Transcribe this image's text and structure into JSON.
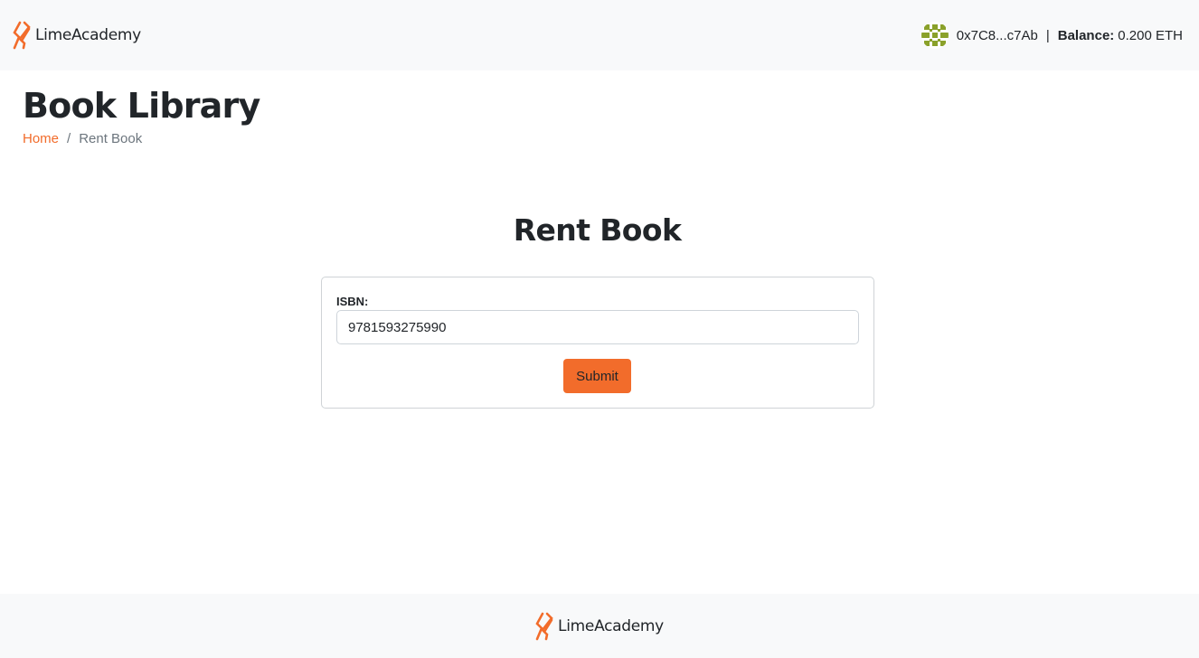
{
  "header": {
    "logo": {
      "brand_primary": "Lime",
      "brand_secondary": "Academy",
      "icon": "limeacademy-logo-icon"
    },
    "account": {
      "avatar_icon": "identicon-avatar",
      "address": "0x7C8...c7Ab",
      "separator": "|",
      "balance_label": "Balance:",
      "balance_value": "0.200 ETH"
    }
  },
  "page": {
    "title": "Book Library",
    "breadcrumb": {
      "home": "Home",
      "separator": "/",
      "current": "Rent Book"
    }
  },
  "form": {
    "title": "Rent Book",
    "isbn_label": "ISBN:",
    "isbn_value": "9781593275990",
    "submit_label": "Submit"
  },
  "footer": {
    "logo": {
      "brand_primary": "Lime",
      "brand_secondary": "Academy",
      "icon": "limeacademy-logo-icon"
    }
  },
  "colors": {
    "accent": "#f26c2b",
    "bar_background": "#f8f9fa",
    "text": "#212529",
    "muted": "#6c757d",
    "avatar": "#8aa12a"
  }
}
